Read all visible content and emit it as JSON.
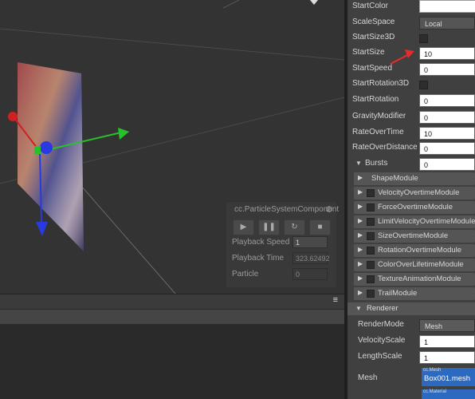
{
  "scene": {
    "component_panel": {
      "title": "cc.ParticleSystemComponent",
      "gear_icon": "gear-icon",
      "buttons": [
        "play-icon",
        "pause-icon",
        "refresh-icon",
        "stop-icon"
      ],
      "rows": [
        {
          "label": "Playback Speed",
          "value": "1"
        },
        {
          "label": "Playback Time",
          "value": "323.62492"
        },
        {
          "label": "Particle",
          "value": "0"
        }
      ]
    }
  },
  "inspector": {
    "properties": [
      {
        "label": "StartColor",
        "kind": "color",
        "value": "#ffffff"
      },
      {
        "label": "ScaleSpace",
        "kind": "select",
        "value": "Local"
      },
      {
        "label": "StartSize3D",
        "kind": "checkbox",
        "value": ""
      },
      {
        "label": "StartSize",
        "kind": "input",
        "value": "10"
      },
      {
        "label": "StartSpeed",
        "kind": "input",
        "value": "0"
      },
      {
        "label": "StartRotation3D",
        "kind": "checkbox",
        "value": ""
      },
      {
        "label": "StartRotation",
        "kind": "input",
        "value": "0"
      },
      {
        "label": "GravityModifier",
        "kind": "input",
        "value": "0"
      },
      {
        "label": "RateOverTime",
        "kind": "input",
        "value": "10"
      },
      {
        "label": "RateOverDistance",
        "kind": "input",
        "value": "0"
      }
    ],
    "bursts": {
      "label": "Bursts",
      "value": "0"
    },
    "modules": [
      "ShapeModule",
      "VelocityOvertimeModule",
      "ForceOvertimeModule",
      "LimitVelocityOvertimeModule",
      "SizeOvertimeModule",
      "RotationOvertimeModule",
      "ColorOverLifetimeModule",
      "TextureAnimationModule",
      "TrailModule"
    ],
    "renderer": {
      "label": "Renderer",
      "rows": [
        {
          "label": "RenderMode",
          "value": "Mesh"
        },
        {
          "label": "VelocityScale",
          "value": "1"
        },
        {
          "label": "LengthScale",
          "value": "1"
        }
      ],
      "mesh": {
        "label": "Mesh",
        "tag": "cc.Mesh",
        "value": "Box001.mesh"
      },
      "material_tag": "cc.Material"
    }
  }
}
